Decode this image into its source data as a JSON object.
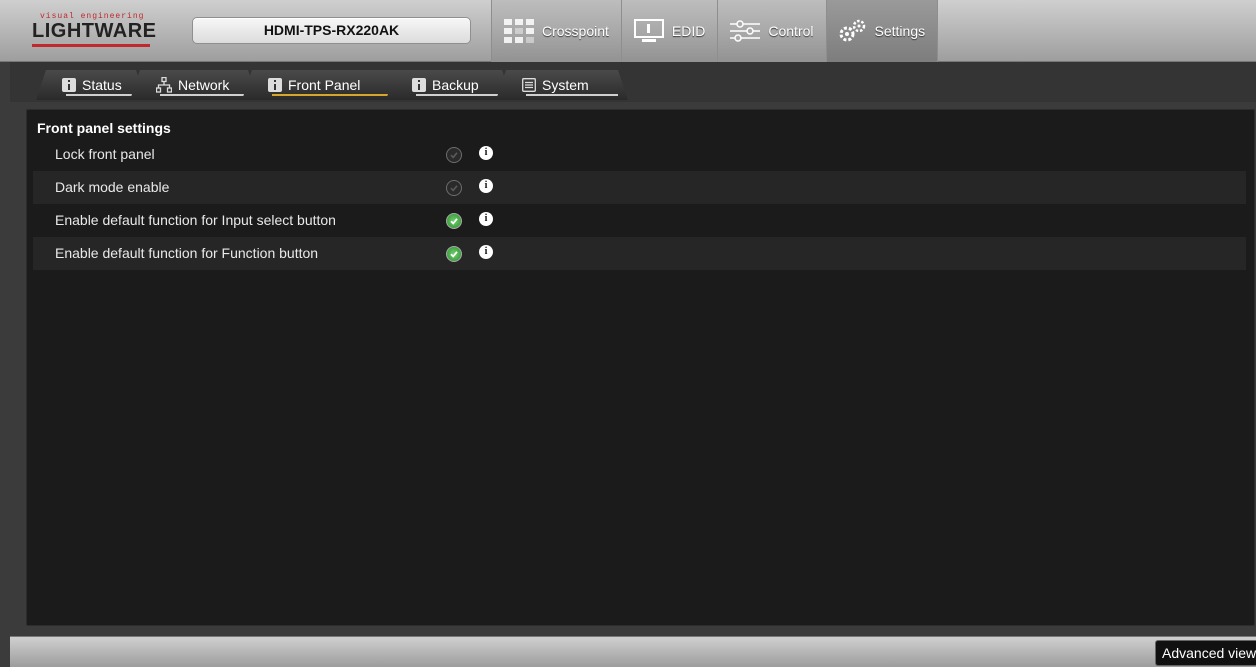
{
  "header": {
    "logo_tagline": "visual engineering",
    "logo_word": "LIGHTWARE",
    "device_name": "HDMI-TPS-RX220AK",
    "main_tabs": [
      {
        "label": "Crosspoint",
        "icon": "crosspoint-grid-icon"
      },
      {
        "label": "EDID",
        "icon": "monitor-icon"
      },
      {
        "label": "Control",
        "icon": "sliders-icon"
      },
      {
        "label": "Settings",
        "icon": "gears-icon",
        "active": true
      }
    ]
  },
  "sub_tabs": [
    {
      "label": "Status",
      "icon": "info-icon"
    },
    {
      "label": "Network",
      "icon": "network-icon"
    },
    {
      "label": "Front Panel",
      "icon": "info-icon",
      "active": true
    },
    {
      "label": "Backup",
      "icon": "info-icon"
    },
    {
      "label": "System",
      "icon": "list-icon"
    }
  ],
  "panel": {
    "title": "Front panel settings",
    "settings": [
      {
        "label": "Lock front panel",
        "enabled": false
      },
      {
        "label": "Dark mode enable",
        "enabled": false
      },
      {
        "label": "Enable default function for Input select button",
        "enabled": true
      },
      {
        "label": "Enable default function for Function button",
        "enabled": true
      }
    ],
    "info_glyph": "i"
  },
  "footer": {
    "advanced_view_label": "Advanced view"
  },
  "colors": {
    "accent_tab_underline": "#d6a62a",
    "check_on": "#3aa53a",
    "brand_red": "#c0282d"
  }
}
